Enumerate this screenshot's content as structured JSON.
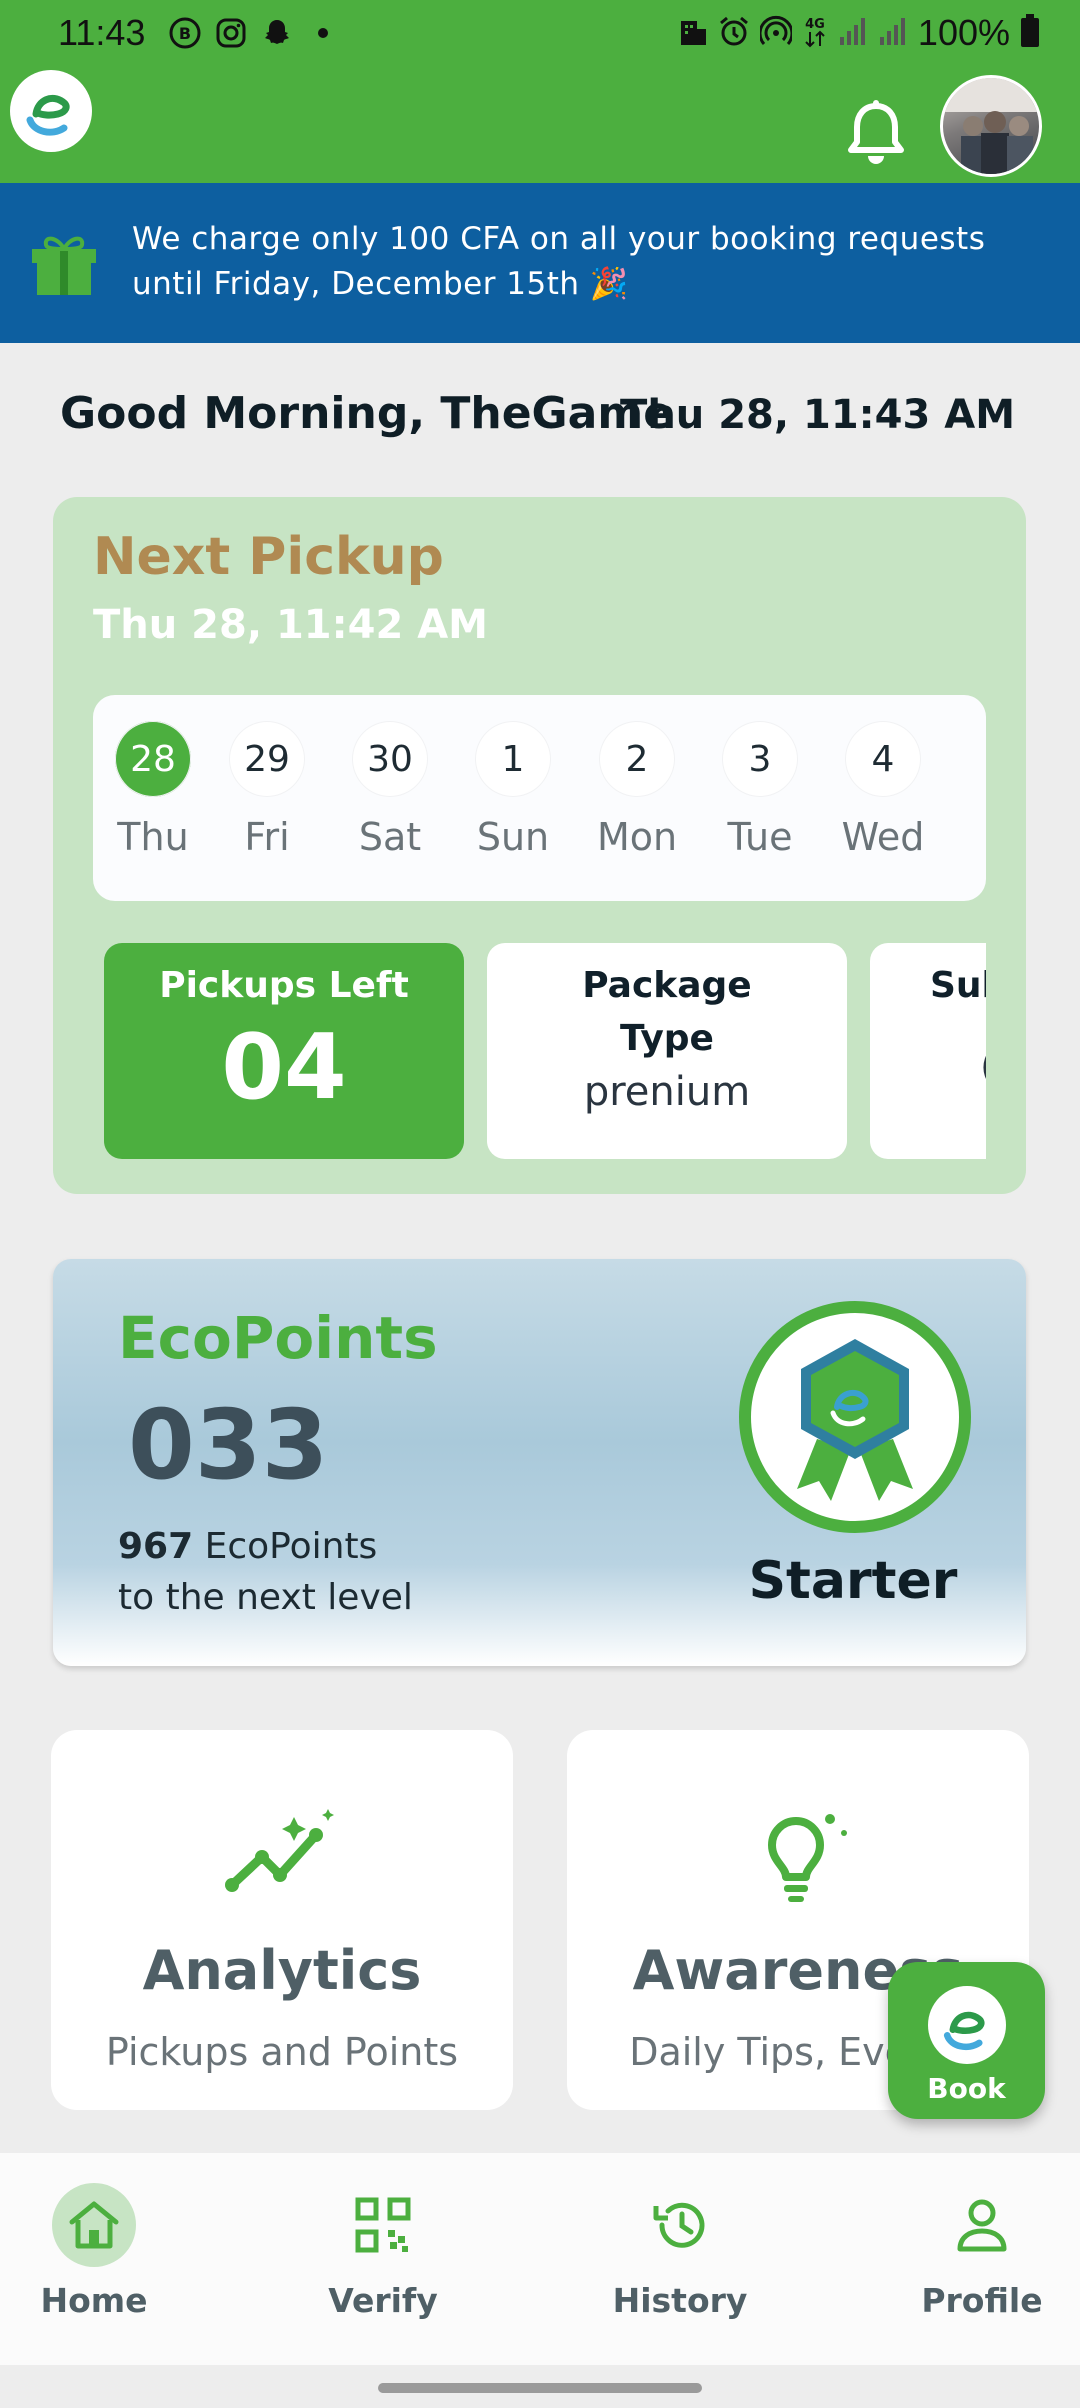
{
  "status_bar": {
    "time": "11:43",
    "battery": "100%",
    "left_icons": [
      "b-circle-icon",
      "instagram-icon",
      "snapchat-icon",
      "dot-icon"
    ],
    "right_icons": [
      "building-icon",
      "alarm-icon",
      "hotspot-icon",
      "4g-icon",
      "signal-icon",
      "signal-icon",
      "battery-icon"
    ]
  },
  "app_bar": {
    "logo_icon": "ecotrash-logo-icon",
    "notification_icon": "bell-icon",
    "avatar_icon": "user-avatar"
  },
  "promo": {
    "icon": "gift-icon",
    "text": "We charge only 100 CFA on all your booking requests until Friday, December 15th 🎉"
  },
  "greeting": {
    "text": "Good Morning, TheGame",
    "datetime": "Thu 28, 11:43 AM"
  },
  "next_pickup": {
    "title": "Next Pickup",
    "datetime": "Thu 28, 11:42 AM",
    "days": [
      {
        "num": "28",
        "name": "Thu",
        "selected": true
      },
      {
        "num": "29",
        "name": "Fri",
        "selected": false
      },
      {
        "num": "30",
        "name": "Sat",
        "selected": false
      },
      {
        "num": "1",
        "name": "Sun",
        "selected": false
      },
      {
        "num": "2",
        "name": "Mon",
        "selected": false
      },
      {
        "num": "3",
        "name": "Tue",
        "selected": false
      },
      {
        "num": "4",
        "name": "Wed",
        "selected": false
      }
    ],
    "stats": {
      "pickups_left_label": "Pickups Left",
      "pickups_left_value": "04",
      "package_type_label": "Package Type",
      "package_type_value": "prenium",
      "third_label": "Sub",
      "third_value": "("
    }
  },
  "ecopoints": {
    "title": "EcoPoints",
    "points": "033",
    "to_next_value": "967",
    "to_next_text": "EcoPoints",
    "to_next_suffix": "to the next level",
    "level": "Starter",
    "badge_icon": "ribbon-badge-icon"
  },
  "features": [
    {
      "title": "Analytics",
      "subtitle": "Pickups and Points",
      "icon": "analytics-icon"
    },
    {
      "title": "Awareness",
      "subtitle": "Daily Tips, Events",
      "icon": "lightbulb-icon"
    }
  ],
  "fab": {
    "label": "Book",
    "icon": "ecotrash-logo-icon"
  },
  "bottom_nav": [
    {
      "label": "Home",
      "icon": "home-icon",
      "active": true
    },
    {
      "label": "Verify",
      "icon": "qr-code-icon",
      "active": false
    },
    {
      "label": "History",
      "icon": "history-icon",
      "active": false
    },
    {
      "label": "Profile",
      "icon": "profile-icon",
      "active": false
    }
  ],
  "colors": {
    "brand_green": "#4caf3f",
    "promo_blue": "#0d5fa0",
    "pickup_card_bg": "#c7e4c4",
    "next_pickup_title": "#b08a52"
  }
}
